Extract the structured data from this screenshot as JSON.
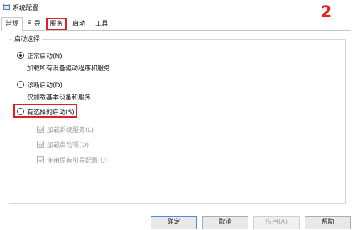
{
  "window": {
    "title": "系统配置",
    "annotation_number": "2"
  },
  "tabs": [
    {
      "label": "常规",
      "active": true
    },
    {
      "label": "引导"
    },
    {
      "label": "服务",
      "highlighted": true
    },
    {
      "label": "启动"
    },
    {
      "label": "工具"
    }
  ],
  "startup": {
    "group_label": "启动选择",
    "options": [
      {
        "label": "正常启动(N)",
        "desc": "加载所有设备驱动程序和服务",
        "checked": true
      },
      {
        "label": "诊断启动(D)",
        "desc": "仅加载基本设备和服务",
        "checked": false
      },
      {
        "label": "有选择的启动(S)",
        "checked": false,
        "highlighted": true
      }
    ],
    "checkboxes": [
      {
        "label": "加载系统服务(L)",
        "checked": true,
        "disabled": true
      },
      {
        "label": "加载启动项(O)",
        "checked": true,
        "disabled": true
      },
      {
        "label": "使用原有引导配置(U)",
        "checked": true,
        "disabled": true
      }
    ]
  },
  "buttons": {
    "ok": "确定",
    "cancel": "取消",
    "apply": "应用(A)",
    "help": "帮助"
  },
  "colors": {
    "annotation_red": "#e11d25",
    "primary_border": "#4a90e2"
  }
}
